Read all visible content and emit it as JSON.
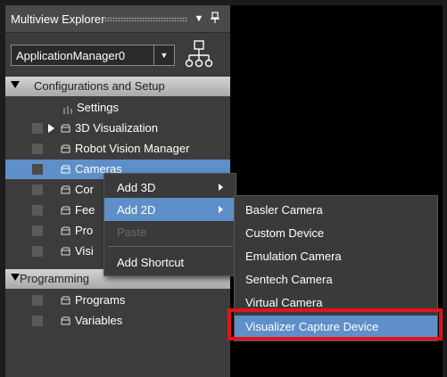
{
  "panel": {
    "title": "Multiview Explorer",
    "collapse_glyph": "▼",
    "pin_glyph": "ᵖ"
  },
  "dropdown": {
    "value": "ApplicationManager0",
    "arrow_glyph": "▼"
  },
  "tree": {
    "sections": [
      {
        "label": "Configurations and Setup"
      },
      {
        "label": "Programming"
      }
    ],
    "items": [
      {
        "label": "Settings"
      },
      {
        "label": "3D Visualization"
      },
      {
        "label": "Robot Vision Manager"
      },
      {
        "label": "Cameras"
      },
      {
        "label": "Cor"
      },
      {
        "label": "Fee"
      },
      {
        "label": "Pro"
      },
      {
        "label": "Visi"
      },
      {
        "label": "Programs"
      },
      {
        "label": "Variables"
      }
    ]
  },
  "context_menu": {
    "items": [
      {
        "label": "Add 3D"
      },
      {
        "label": "Add 2D"
      },
      {
        "label": "Paste"
      },
      {
        "label": "Add Shortcut"
      }
    ]
  },
  "submenu": {
    "items": [
      {
        "label": "Basler Camera"
      },
      {
        "label": "Custom Device"
      },
      {
        "label": "Emulation Camera"
      },
      {
        "label": "Sentech Camera"
      },
      {
        "label": "Virtual Camera"
      },
      {
        "label": "Visualizer Capture Device"
      }
    ]
  },
  "colors": {
    "selection": "#5e8fc8",
    "highlight_box": "#e0141b"
  }
}
